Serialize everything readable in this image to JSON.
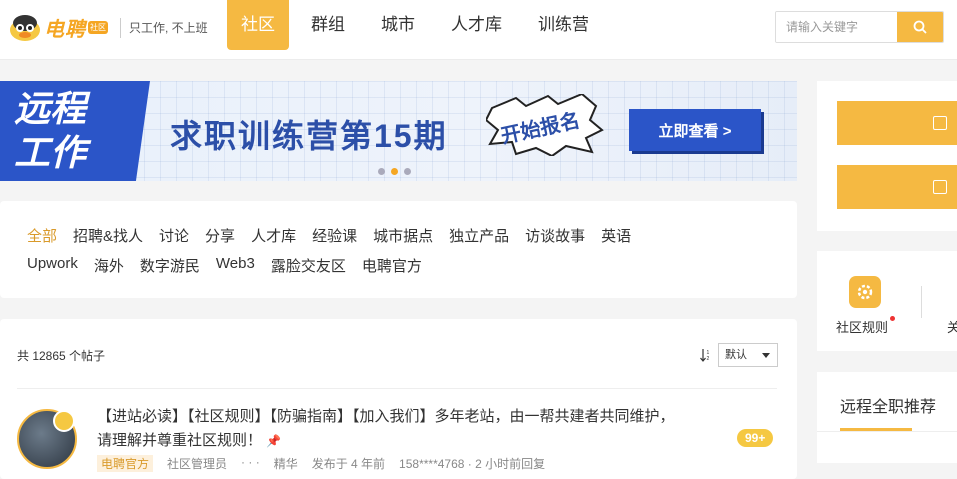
{
  "brand": {
    "name": "电聘",
    "badge": "社区",
    "slogan": "只工作, 不上班"
  },
  "nav": {
    "items": [
      {
        "label": "社区",
        "active": true
      },
      {
        "label": "群组",
        "active": false
      },
      {
        "label": "城市",
        "active": false
      },
      {
        "label": "人才库",
        "active": false
      },
      {
        "label": "训练营",
        "active": false
      }
    ]
  },
  "search": {
    "placeholder": "请输入关键字"
  },
  "banner": {
    "left_line1": "远程",
    "left_line2": "工作",
    "title": "求职训练营第15期",
    "burst": "开始报名",
    "cta": "立即查看 >"
  },
  "categories": {
    "row1": [
      "全部",
      "招聘&找人",
      "讨论",
      "分享",
      "人才库",
      "经验课",
      "城市据点",
      "独立产品",
      "访谈故事",
      "英语"
    ],
    "row2": [
      "Upwork",
      "海外",
      "数字游民",
      "Web3",
      "露脸交友区",
      "电聘官方"
    ],
    "active": "全部"
  },
  "posts": {
    "count_text": "共 12865 个帖子",
    "sort_value": "默认",
    "first": {
      "title_line1": "【进站必读】【社区规则】【防骗指南】【加入我们】多年老站，由一帮共建者共同维护，",
      "title_line2": "请理解并尊重社区规则！",
      "reply_count": "99+",
      "meta": [
        "电聘官方",
        "社区管理员",
        "· · ·",
        "精华",
        "发布于 4 年前",
        "158****4768 · 2 小时前回复"
      ]
    }
  },
  "sidebar": {
    "rule_label": "社区规则",
    "second_label": "关",
    "recommend_title": "远程全职推荐"
  },
  "colors": {
    "accent": "#f5b942",
    "brand_blue": "#2b55c8"
  }
}
